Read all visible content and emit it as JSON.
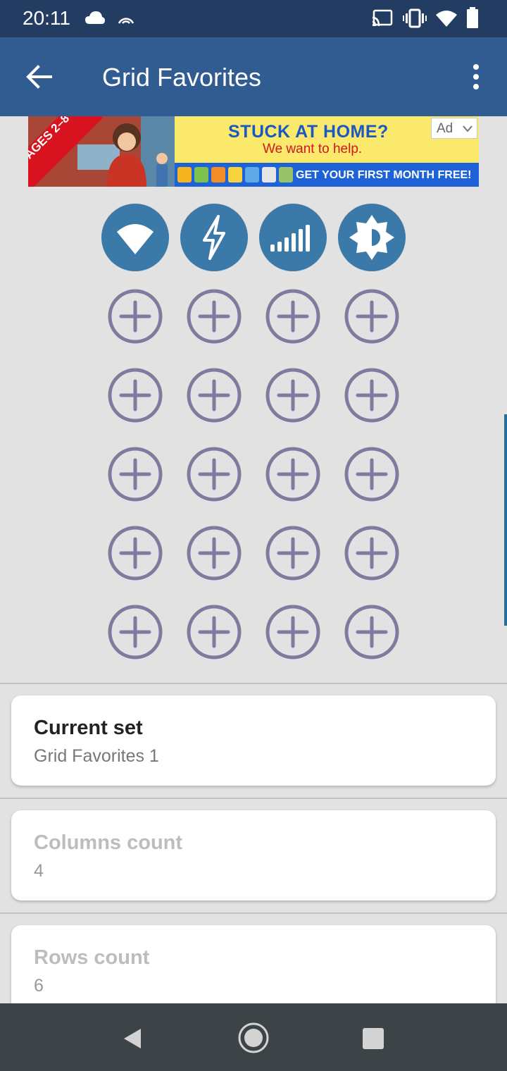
{
  "status_bar": {
    "time": "20:11",
    "icons": [
      "cloud-icon",
      "hotspot-icon",
      "cast-icon",
      "vibrate-icon",
      "wifi-icon",
      "battery-icon"
    ]
  },
  "app_bar": {
    "title": "Grid Favorites",
    "back_icon": "arrow-back-icon",
    "menu_icon": "more-vert-icon"
  },
  "ad": {
    "badge": "AGES 2–8",
    "headline": "STUCK AT HOME?",
    "subline": "We want to help.",
    "cta": "GET YOUR FIRST MONTH FREE!",
    "label": "Ad"
  },
  "grid": {
    "columns": 4,
    "rows": 6,
    "favorites": [
      {
        "icon": "wifi-icon",
        "color": "#3b79a8"
      },
      {
        "icon": "flash-icon",
        "color": "#3b79a8"
      },
      {
        "icon": "signal-icon",
        "color": "#3b79a8"
      },
      {
        "icon": "brightness-icon",
        "color": "#3b79a8"
      }
    ],
    "empty_slot_icon": "add-circle-icon",
    "empty_slot_color": "#7e7b9e"
  },
  "settings": {
    "current_set": {
      "title": "Current set",
      "value": "Grid Favorites 1"
    },
    "columns_count": {
      "title": "Columns count",
      "value": "4"
    },
    "rows_count": {
      "title": "Rows count",
      "value": "6"
    }
  },
  "nav_bar": {
    "icons": [
      "nav-back-icon",
      "nav-home-icon",
      "nav-recents-icon"
    ]
  }
}
